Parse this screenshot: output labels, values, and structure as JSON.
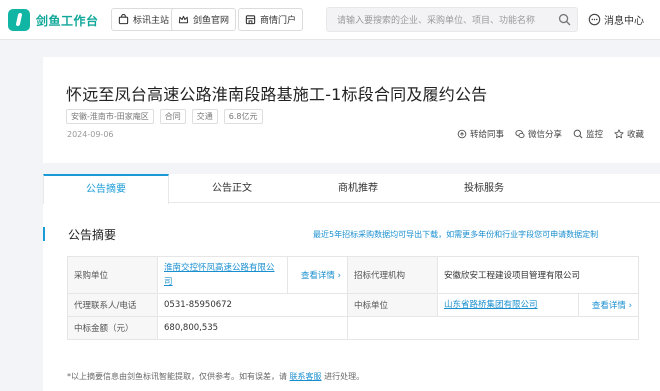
{
  "header": {
    "logo_text": "剑鱼工作台",
    "nav": [
      {
        "label": "标讯主站",
        "icon": "bag-icon"
      },
      {
        "label": "剑鱼官网",
        "icon": "crown-icon"
      },
      {
        "label": "商情门户",
        "icon": "storefront-icon"
      }
    ],
    "search_placeholder": "请输入要搜索的企业、采购单位、项目、功能名称",
    "message_center": "消息中心"
  },
  "notice": {
    "title": "怀远至凤台高速公路淮南段路基施工-1标段合同及履约公告",
    "tags": [
      "安徽-淮南市-田家庵区",
      "合同",
      "交通",
      "6.8亿元"
    ],
    "date": "2024-09-06",
    "actions": [
      {
        "label": "转给同事",
        "icon": "share-colleague-icon"
      },
      {
        "label": "微信分享",
        "icon": "wechat-icon"
      },
      {
        "label": "监控",
        "icon": "monitor-icon"
      },
      {
        "label": "收藏",
        "icon": "star-icon"
      }
    ]
  },
  "tabs": [
    "公告摘要",
    "公告正文",
    "商机推荐",
    "投标服务"
  ],
  "summary": {
    "title": "公告摘要",
    "export_link": "最近5年招标采购数据均可导出下载，如需更多年份和行业字段您可申请数据定制",
    "rows": [
      {
        "label1": "采购单位",
        "value1": "淮南交控怀凤高速公路有限公司",
        "more1": "查看详情",
        "label2": "招标代理机构",
        "value2": "安徽欣安工程建设项目管理有限公司"
      },
      {
        "label1": "代理联系人/电话",
        "value1": "0531-85950672",
        "label2": "中标单位",
        "value2": "山东省路桥集团有限公司",
        "more2": "查看详情"
      },
      {
        "label1": "中标金额（元）",
        "value1": "680,800,535"
      }
    ],
    "note_prefix": "*以上摘要信息由剑鱼标讯智能提取，仅供参考。如有误差，请",
    "note_link": "联系客服",
    "note_suffix": "进行处理。"
  },
  "colors": {
    "brand": "#11b5a3",
    "accent": "#1a9bd7"
  }
}
